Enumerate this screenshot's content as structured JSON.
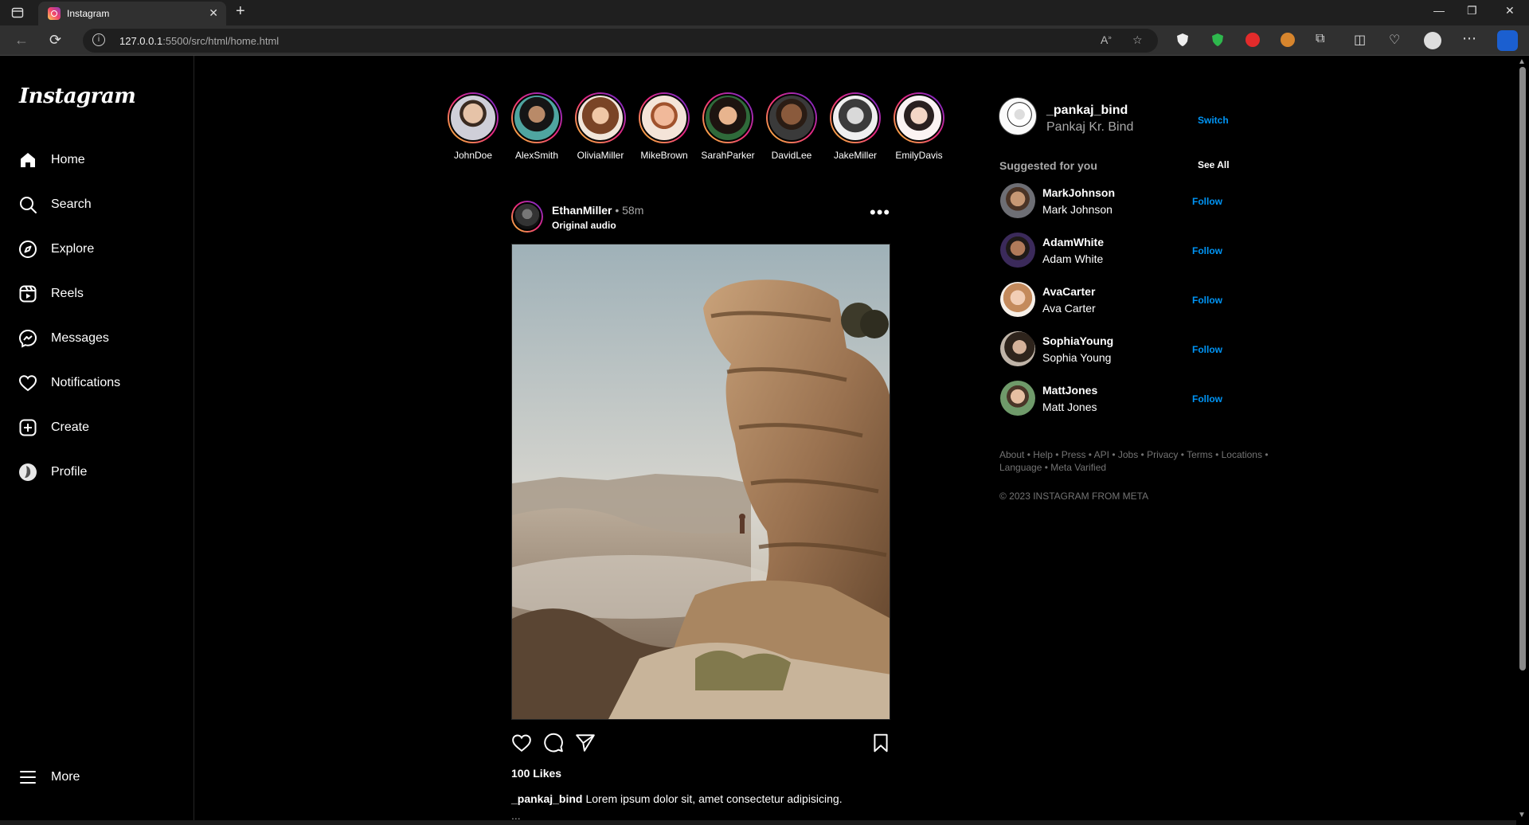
{
  "browser": {
    "tab_title": "Instagram",
    "url_host": "127.0.0.1",
    "url_rest": ":5500/src/html/home.html"
  },
  "sidebar": {
    "logo": "Instagram",
    "items": [
      {
        "label": "Home",
        "icon": "home-icon"
      },
      {
        "label": "Search",
        "icon": "search-icon"
      },
      {
        "label": "Explore",
        "icon": "compass-icon"
      },
      {
        "label": "Reels",
        "icon": "reels-icon"
      },
      {
        "label": "Messages",
        "icon": "messenger-icon"
      },
      {
        "label": "Notifications",
        "icon": "heart-icon"
      },
      {
        "label": "Create",
        "icon": "plus-square-icon"
      },
      {
        "label": "Profile",
        "icon": "avatar-icon"
      }
    ],
    "more": "More"
  },
  "stories": [
    {
      "name": "JohnDoe"
    },
    {
      "name": "AlexSmith"
    },
    {
      "name": "OliviaMiller"
    },
    {
      "name": "MikeBrown"
    },
    {
      "name": "SarahParker"
    },
    {
      "name": "DavidLee"
    },
    {
      "name": "JakeMiller"
    },
    {
      "name": "EmilyDavis"
    }
  ],
  "post": {
    "user": "EthanMiller",
    "time": "• 58m",
    "audio": "Original audio",
    "likes": "100 Likes",
    "caption_user": "_pankaj_bind",
    "caption_text": "Lorem ipsum dolor sit, amet consectetur adipisicing.",
    "caption_more": "..."
  },
  "current_user": {
    "username": "_pankaj_bind",
    "name": "Pankaj Kr. Bind",
    "switch": "Switch"
  },
  "suggestions": {
    "title": "Suggested for you",
    "see_all": "See All",
    "follow_label": "Follow",
    "items": [
      {
        "username": "MarkJohnson",
        "name": "Mark Johnson"
      },
      {
        "username": "AdamWhite",
        "name": "Adam White"
      },
      {
        "username": "AvaCarter",
        "name": "Ava Carter"
      },
      {
        "username": "SophiaYoung",
        "name": "Sophia Young"
      },
      {
        "username": "MattJones",
        "name": "Matt Jones"
      }
    ]
  },
  "footer": {
    "links": "About • Help • Press • API • Jobs • Privacy • Terms • Locations • Language • Meta Varified",
    "copyright": "© 2023 INSTAGRAM FROM META"
  },
  "colors": {
    "background": "#000000",
    "link_blue": "#0095f6",
    "muted_text": "#a8a8a8"
  }
}
